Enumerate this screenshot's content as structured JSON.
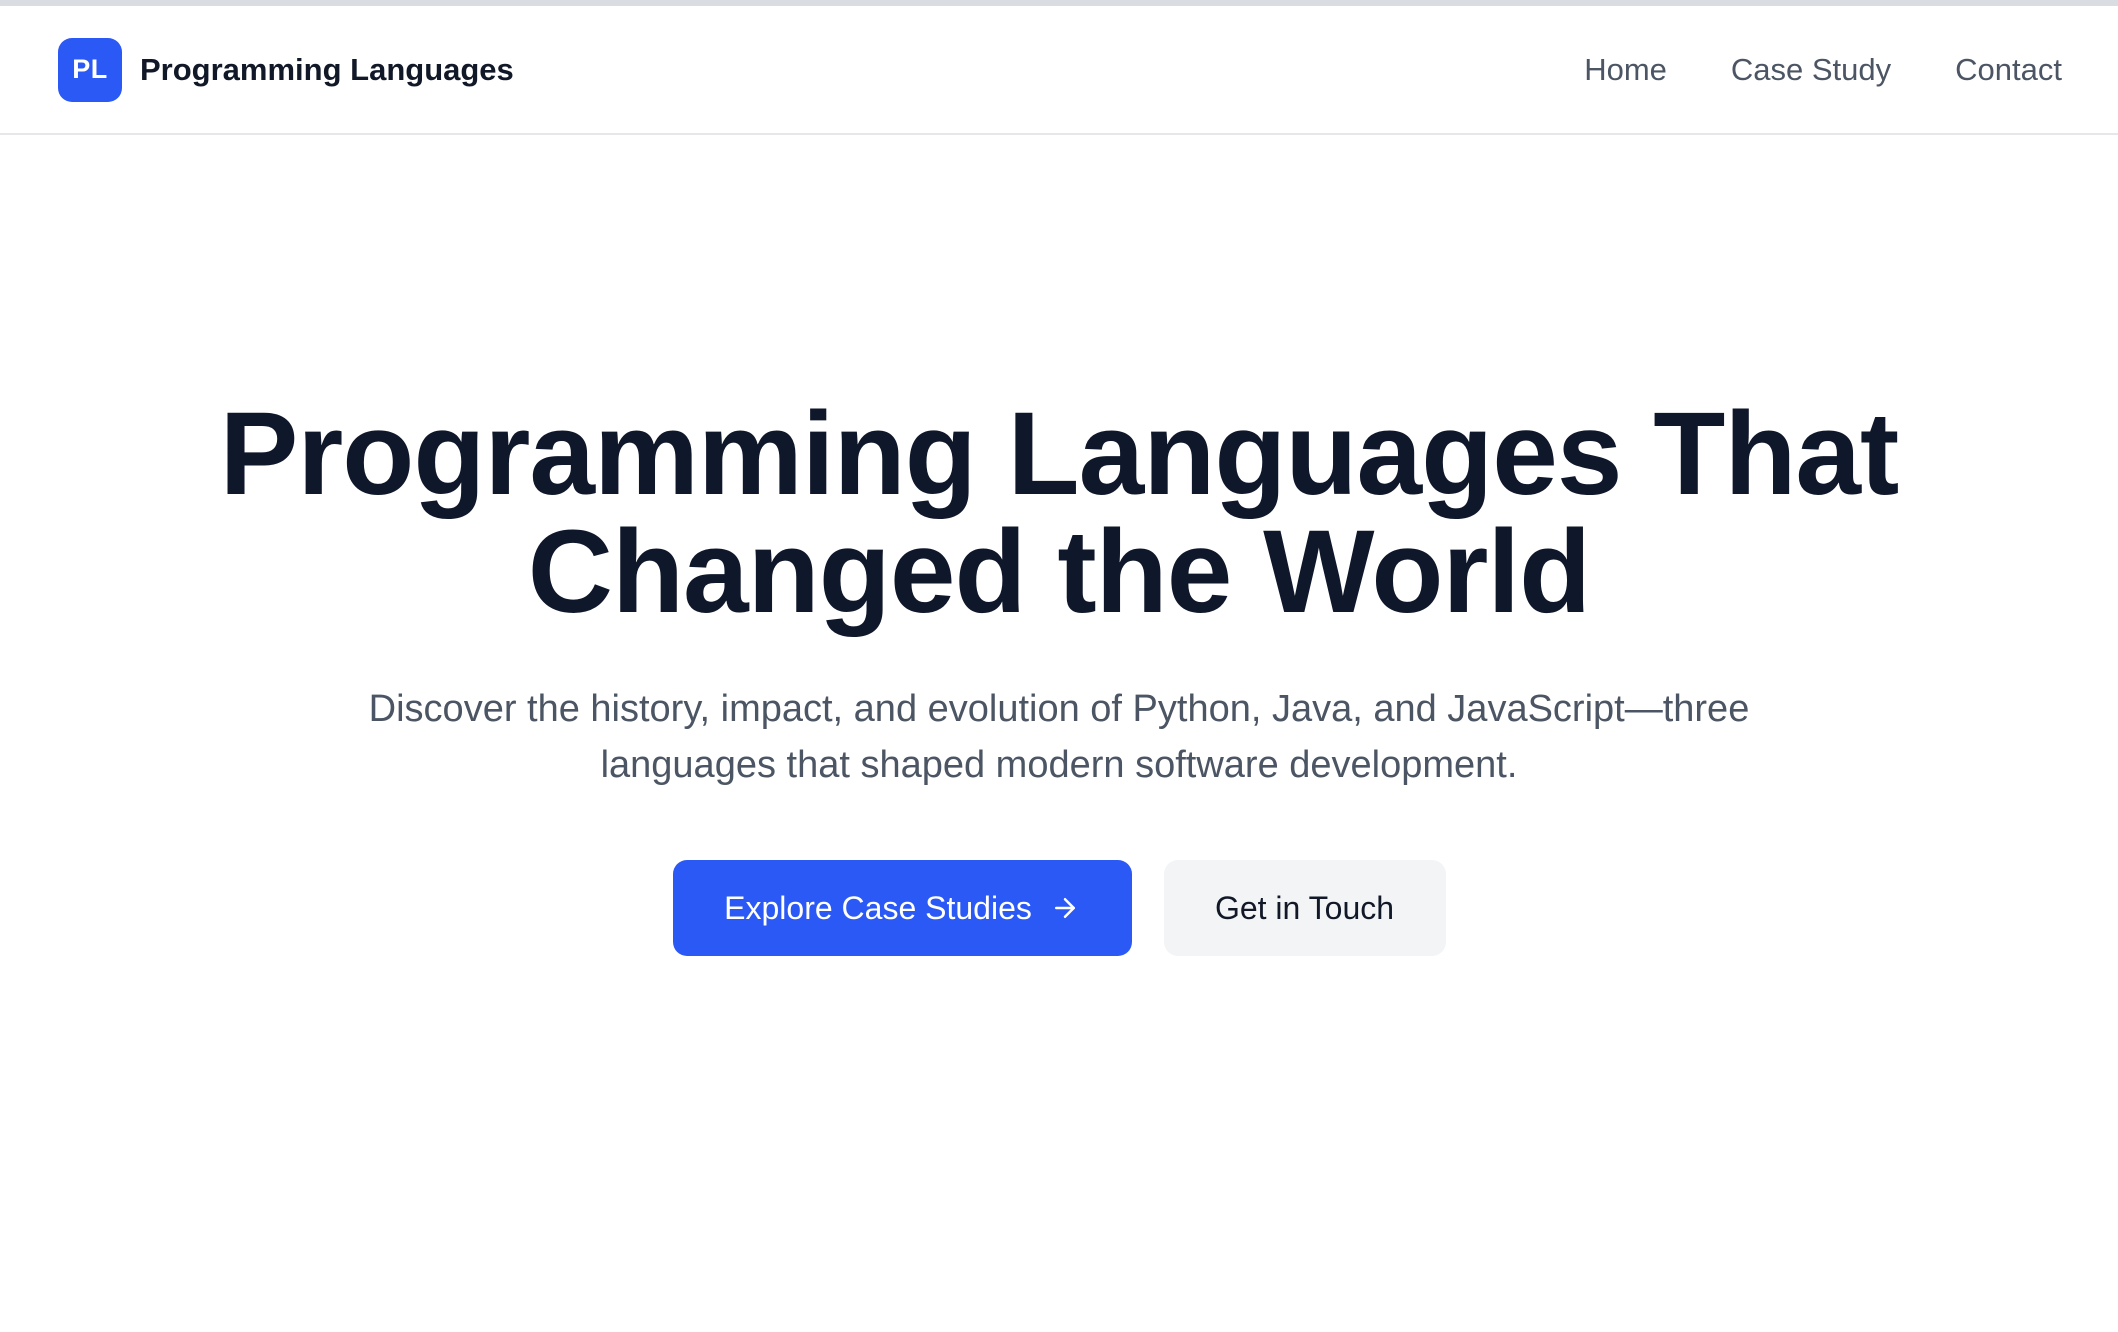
{
  "brand": {
    "logo_text": "PL",
    "name": "Programming Languages"
  },
  "nav": {
    "items": [
      {
        "label": "Home"
      },
      {
        "label": "Case Study"
      },
      {
        "label": "Contact"
      }
    ]
  },
  "hero": {
    "title": "Programming Languages That Changed the World",
    "subtitle": "Discover the history, impact, and evolution of Python, Java, and JavaScript—three languages that shaped modern software development.",
    "primary_button": {
      "label": "Explore Case Studies",
      "icon": "arrow-right-icon"
    },
    "secondary_button": {
      "label": "Get in Touch"
    }
  },
  "colors": {
    "accent": "#2b59f5",
    "heading": "#0f172a",
    "body_text": "#4b5563",
    "secondary_button_bg": "#f3f4f6"
  }
}
